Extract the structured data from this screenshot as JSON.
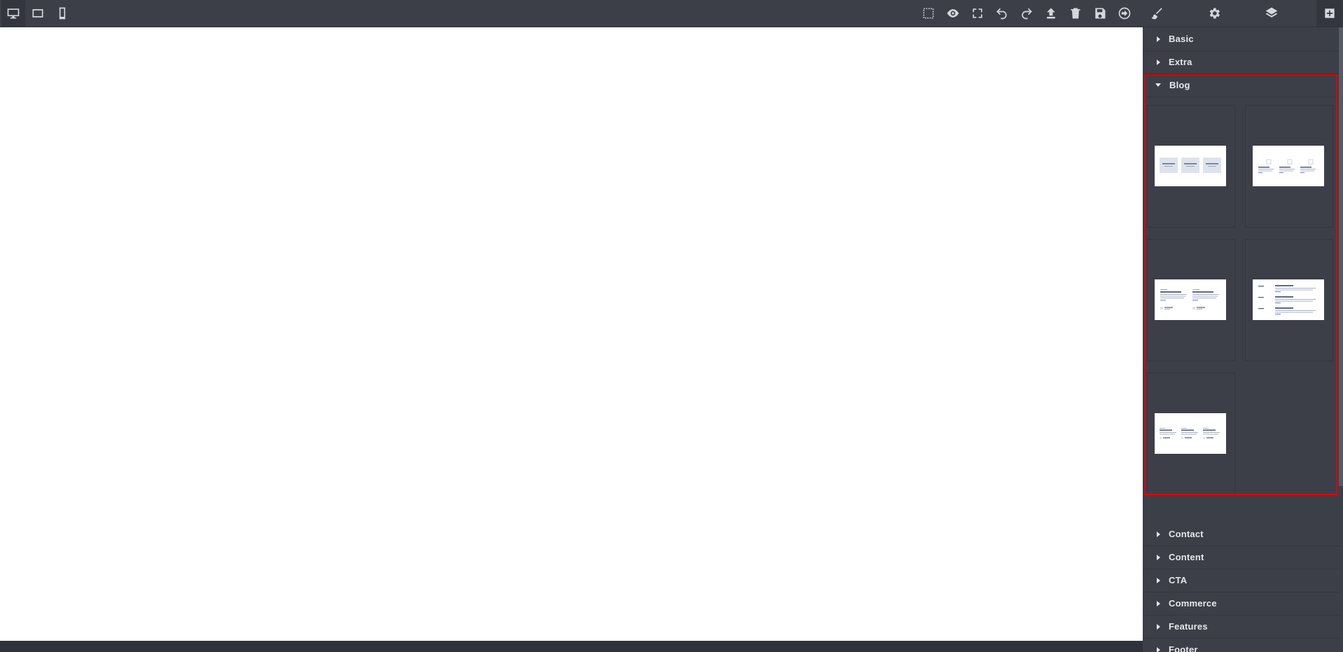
{
  "toolbar": {
    "devices": [
      {
        "name": "desktop-device-button",
        "icon": "monitor-icon",
        "active": true
      },
      {
        "name": "tablet-device-button",
        "icon": "tablet-icon",
        "active": false
      },
      {
        "name": "mobile-device-button",
        "icon": "mobile-icon",
        "active": false
      }
    ],
    "options": [
      {
        "name": "sw-visibility-button",
        "icon": "dashed-square-icon"
      },
      {
        "name": "preview-button",
        "icon": "eye-icon"
      },
      {
        "name": "fullscreen-button",
        "icon": "fullscreen-icon"
      },
      {
        "name": "undo-button",
        "icon": "undo-icon"
      },
      {
        "name": "redo-button",
        "icon": "redo-icon"
      },
      {
        "name": "import-button",
        "icon": "upload-icon"
      },
      {
        "name": "clear-canvas-button",
        "icon": "trash-icon"
      },
      {
        "name": "save-button",
        "icon": "floppy-icon"
      },
      {
        "name": "export-button",
        "icon": "arrow-circle-icon"
      }
    ],
    "panels": [
      {
        "name": "style-manager-button",
        "icon": "paintbrush-icon"
      },
      {
        "name": "settings-button",
        "icon": "gear-icon"
      },
      {
        "name": "layer-manager-button",
        "icon": "layers-icon"
      },
      {
        "name": "blocks-button",
        "icon": "plus-square-icon",
        "active": true
      }
    ]
  },
  "blocks_panel": {
    "categories_top": [
      {
        "label": "Basic"
      },
      {
        "label": "Extra"
      }
    ],
    "open_category": {
      "label": "Blog",
      "blocks": [
        "blog-block-1",
        "blog-block-2",
        "blog-block-3",
        "blog-block-4",
        "blog-block-5"
      ]
    },
    "categories_bottom": [
      {
        "label": "Contact"
      },
      {
        "label": "Content"
      },
      {
        "label": "CTA"
      },
      {
        "label": "Commerce"
      },
      {
        "label": "Features"
      },
      {
        "label": "Footer"
      }
    ]
  },
  "colors": {
    "panel_bg": "#3c3f48",
    "highlight": "#e00000",
    "canvas_bg": "#ffffff"
  }
}
